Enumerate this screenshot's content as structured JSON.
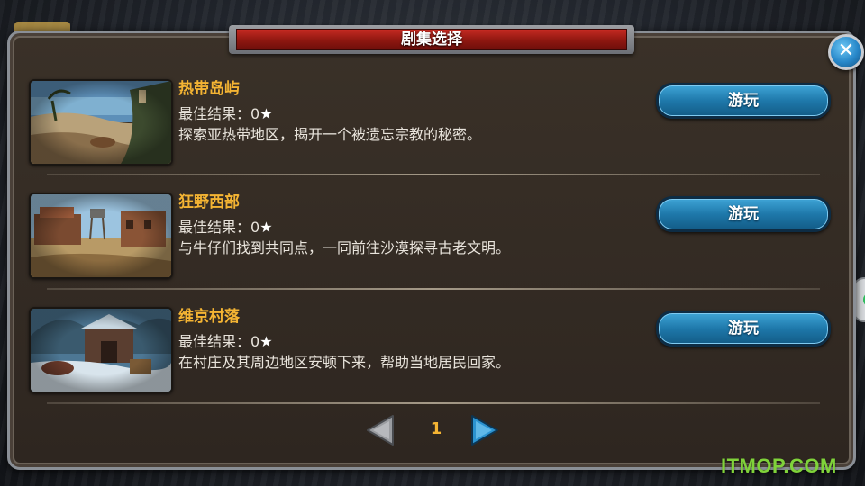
{
  "dialog": {
    "title": "剧集选择",
    "close_symbol": "✕"
  },
  "episodes": [
    {
      "name": "热带岛屿",
      "best_label": "最佳结果：",
      "best_value": "0",
      "star": "★",
      "description": "探索亚热带地区，揭开一个被遗忘宗教的秘密。",
      "play_label": "游玩",
      "thumbnail": "tropical-island-thumbnail"
    },
    {
      "name": "狂野西部",
      "best_label": "最佳结果：",
      "best_value": "0",
      "star": "★",
      "description": "与牛仔们找到共同点，一同前往沙漠探寻古老文明。",
      "play_label": "游玩",
      "thumbnail": "wild-west-thumbnail"
    },
    {
      "name": "维京村落",
      "best_label": "最佳结果：",
      "best_value": "0",
      "star": "★",
      "description": "在村庄及其周边地区安顿下来，帮助当地居民回家。",
      "play_label": "游玩",
      "thumbnail": "viking-village-thumbnail"
    }
  ],
  "pagination": {
    "current_page": "1",
    "prev_icon": "triangle-left-icon",
    "next_icon": "triangle-right-icon",
    "prev_enabled": false,
    "next_enabled": true
  },
  "watermark": "ITMOP.COM",
  "colors": {
    "episode_title": "#f4b433",
    "title_bar_red": "#8e1710",
    "button_blue": "#1e78aa",
    "next_arrow_blue": "#2b93d1",
    "prev_arrow_gray": "#9a9ca0",
    "watermark_green": "#7fd23a"
  }
}
